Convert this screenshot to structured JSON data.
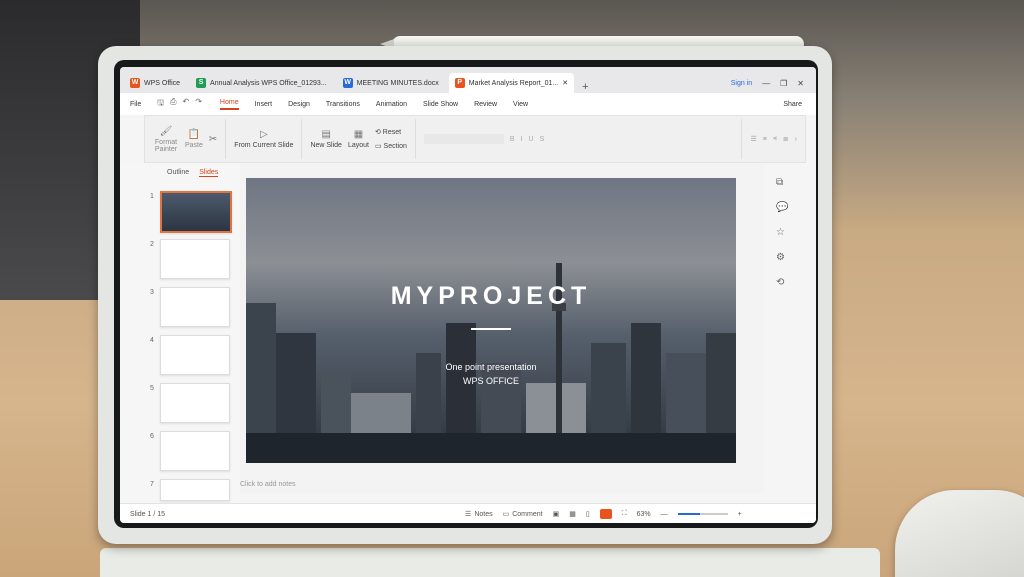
{
  "tabs": [
    {
      "label": "WPS Office",
      "icon": "wps-logo-icon",
      "color": "#e8541e"
    },
    {
      "label": "Annual Analysis WPS Office_01293...",
      "icon": "spreadsheet-icon",
      "color": "#1f9d55"
    },
    {
      "label": "MEETING MINUTES.docx",
      "icon": "document-icon",
      "color": "#2a6ad8"
    },
    {
      "label": "Market Analysis Report_01...",
      "icon": "presentation-icon",
      "color": "#e8541e"
    }
  ],
  "signin": "Sign in",
  "menu": {
    "file": "File",
    "items": [
      "Home",
      "Insert",
      "Design",
      "Transitions",
      "Animation",
      "Slide Show",
      "Review",
      "View"
    ],
    "share": "Share"
  },
  "ribbon": {
    "format_painter": "Format Painter",
    "paste": "Paste",
    "from_current_slide": "From Current Slide",
    "new_slide": "New Slide",
    "layout": "Layout",
    "reset": "Reset",
    "section": "Section"
  },
  "leftpanel": {
    "outline": "Outline",
    "slides": "Slides",
    "numbers": [
      "1",
      "2",
      "3",
      "4",
      "5",
      "6",
      "7"
    ]
  },
  "slide": {
    "title": "MYPROJECT",
    "subtitle1": "One point presentation",
    "subtitle2": "WPS OFFICE"
  },
  "notes_placeholder": "Click to add notes",
  "status": {
    "slide": "Slide 1 / 15",
    "notes": "Notes",
    "comment": "Comment",
    "zoom": "63%"
  }
}
